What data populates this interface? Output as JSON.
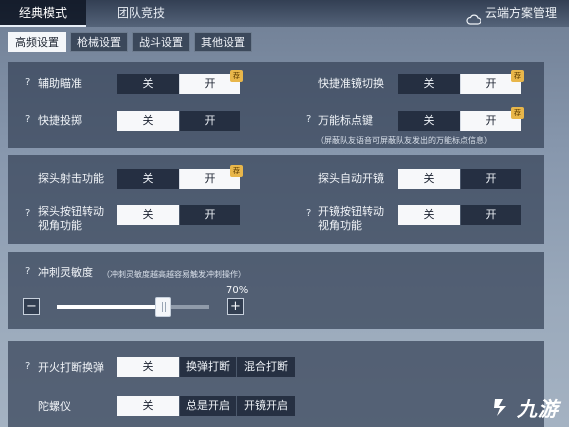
{
  "mode_tabs": [
    {
      "label": "经典模式",
      "active": true
    },
    {
      "label": "团队竞技",
      "active": false
    }
  ],
  "cloud": {
    "label": "云端方案管理",
    "icon": "cloud-icon"
  },
  "sub_tabs": [
    {
      "label": "高频设置",
      "active": true
    },
    {
      "label": "枪械设置",
      "active": false
    },
    {
      "label": "战斗设置",
      "active": false
    },
    {
      "label": "其他设置",
      "active": false
    }
  ],
  "help_symbol": "?",
  "recommend_badge": "荐",
  "section1": {
    "aim_assist": {
      "label": "辅助瞄准",
      "options": [
        "关",
        "开"
      ],
      "selected": "开",
      "recommended": true
    },
    "quick_scope": {
      "label": "快捷准镜切换",
      "options": [
        "关",
        "开"
      ],
      "selected": "开",
      "recommended": true
    },
    "quick_throw": {
      "label": "快捷投掷",
      "options": [
        "关",
        "开"
      ],
      "selected": "关"
    },
    "universal_marker": {
      "label": "万能标点键",
      "options": [
        "关",
        "开"
      ],
      "selected": "开",
      "recommended": true
    },
    "marker_note": "（屏蔽队友语音可屏蔽队友发出的万能标点信息）"
  },
  "section2": {
    "peek_fire": {
      "label": "探头射击功能",
      "options": [
        "关",
        "开"
      ],
      "selected": "开",
      "recommended": true
    },
    "peek_auto_scope": {
      "label": "探头自动开镜",
      "options": [
        "关",
        "开"
      ],
      "selected": "关"
    },
    "peek_button_view": {
      "label": "探头按钮转动视角功能",
      "label_line1": "探头按钮转动",
      "label_line2": "视角功能",
      "options": [
        "关",
        "开"
      ],
      "selected": "关"
    },
    "scope_button_view": {
      "label": "开镜按钮转动视角功能",
      "label_line1": "开镜按钮转动",
      "label_line2": "视角功能",
      "options": [
        "关",
        "开"
      ],
      "selected": "关"
    }
  },
  "section3": {
    "sprint_sensitivity": {
      "label": "冲刺灵敏度",
      "note": "（冲刺灵敏度越高越容易触发冲刺操作）",
      "value": 0.7,
      "value_label": "70%"
    },
    "minus_label": "−",
    "plus_label": "+"
  },
  "section4": {
    "fire_reload": {
      "label": "开火打断换弹",
      "options": [
        "关",
        "换弹打断",
        "混合打断"
      ],
      "selected": "关"
    },
    "gyroscope": {
      "label": "陀螺仪",
      "options": [
        "关",
        "总是开启",
        "开镜开启"
      ],
      "selected": "关"
    }
  },
  "watermark": {
    "text": "九游"
  },
  "colors": {
    "panel": "#364258",
    "selected": "#f7f8fa",
    "badge": "#e8b64a"
  }
}
